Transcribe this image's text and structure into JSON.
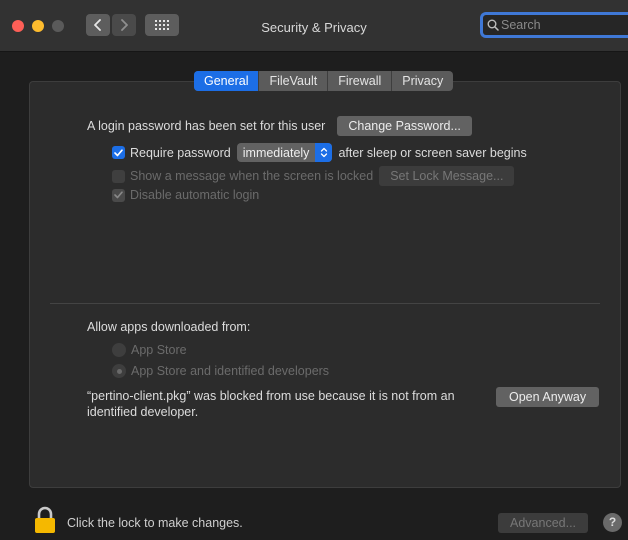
{
  "window": {
    "title": "Security & Privacy"
  },
  "search": {
    "placeholder": "Search"
  },
  "tabs": [
    {
      "label": "General",
      "active": true
    },
    {
      "label": "FileVault",
      "active": false
    },
    {
      "label": "Firewall",
      "active": false
    },
    {
      "label": "Privacy",
      "active": false
    }
  ],
  "general": {
    "login_password_text": "A login password has been set for this user",
    "change_password_label": "Change Password...",
    "require_password_label": "Require password",
    "require_password_checked": true,
    "require_password_value": "immediately",
    "require_password_suffix": "after sleep or screen saver begins",
    "show_message_label": "Show a message when the screen is locked",
    "show_message_checked": false,
    "set_lock_message_label": "Set Lock Message...",
    "disable_auto_login_label": "Disable automatic login",
    "disable_auto_login_checked": true
  },
  "apps": {
    "heading": "Allow apps downloaded from:",
    "options": [
      {
        "label": "App Store",
        "selected": false
      },
      {
        "label": "App Store and identified developers",
        "selected": true
      }
    ],
    "blocked_message": "“pertino-client.pkg” was blocked from use because it is not from an identified developer.",
    "open_anyway_label": "Open Anyway"
  },
  "footer": {
    "lock_text": "Click the lock to make changes.",
    "advanced_label": "Advanced...",
    "help_label": "?"
  },
  "colors": {
    "accent": "#1c6ee6",
    "lock": "#f5b800"
  }
}
